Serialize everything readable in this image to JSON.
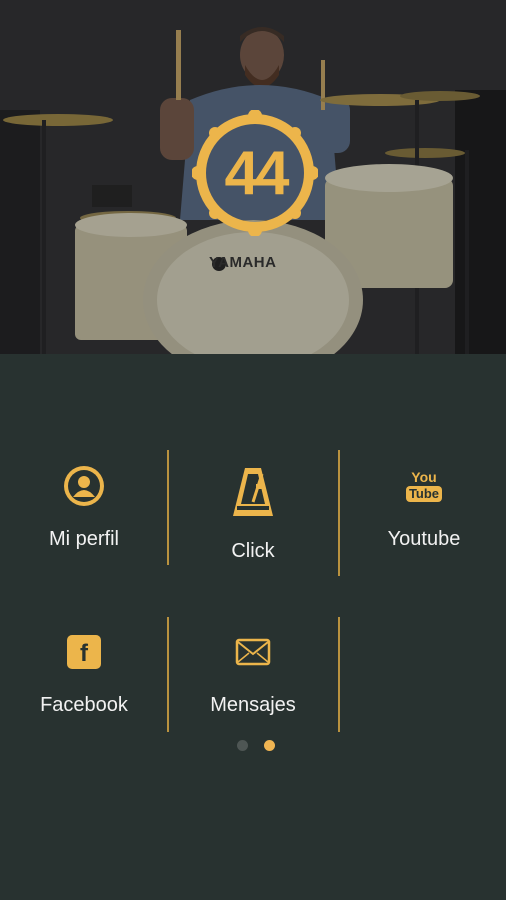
{
  "hero": {
    "logo_text": "44",
    "kick_brand": "YAMAHA"
  },
  "menu": {
    "items": [
      {
        "label": "Mi perfil",
        "icon": "profile-icon"
      },
      {
        "label": "Click",
        "icon": "metronome-icon"
      },
      {
        "label": "Youtube",
        "icon": "youtube-icon"
      },
      {
        "label": "Facebook",
        "icon": "facebook-icon"
      },
      {
        "label": "Mensajes",
        "icon": "messages-icon"
      }
    ],
    "youtube_icon_text": [
      "You",
      "Tube"
    ],
    "facebook_icon_text": "f"
  },
  "pager": {
    "total": 2,
    "active": 2
  },
  "colors": {
    "accent": "#ecb54b",
    "background": "#283230",
    "divider": "#b9923f",
    "dot_inactive": "#4e5654",
    "dot_active": "#f0b552"
  }
}
